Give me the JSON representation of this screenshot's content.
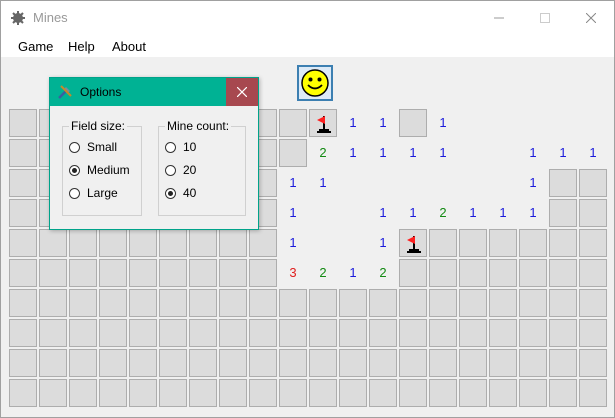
{
  "window": {
    "title": "Mines"
  },
  "menu": {
    "items": [
      "Game",
      "Help",
      "About"
    ]
  },
  "board": {
    "rows": [
      [
        "closed",
        "closed",
        "closed",
        "closed",
        "closed",
        "closed",
        "closed",
        "closed",
        "closed",
        "closed",
        "flag",
        "1",
        "1",
        "closed",
        "1",
        "",
        "",
        "",
        ""
      ],
      [
        "closed",
        "closed",
        "closed",
        "closed",
        "closed",
        "closed",
        "closed",
        "closed",
        "closed",
        "closed",
        "2",
        "1",
        "1",
        "1",
        "1",
        "",
        "",
        "1",
        "1",
        "1"
      ],
      [
        "closed",
        "closed",
        "closed",
        "closed",
        "closed",
        "closed",
        "closed",
        "closed",
        "closed",
        "1",
        "1",
        "",
        "",
        "",
        "",
        "",
        "",
        "1",
        "closed",
        "closed"
      ],
      [
        "closed",
        "closed",
        "closed",
        "closed",
        "closed",
        "closed",
        "closed",
        "closed",
        "closed",
        "1",
        "",
        "",
        "1",
        "1",
        "2",
        "1",
        "1",
        "1",
        "closed",
        "closed"
      ],
      [
        "closed",
        "closed",
        "closed",
        "closed",
        "closed",
        "closed",
        "closed",
        "closed",
        "closed",
        "1",
        "",
        "",
        "1",
        "flag",
        "closed",
        "closed",
        "closed",
        "closed",
        "closed",
        "closed"
      ],
      [
        "closed",
        "closed",
        "closed",
        "closed",
        "closed",
        "closed",
        "closed",
        "closed",
        "closed",
        "3",
        "2",
        "1",
        "2",
        "closed",
        "closed",
        "closed",
        "closed",
        "closed",
        "closed",
        "closed"
      ],
      [
        "closed",
        "closed",
        "closed",
        "closed",
        "closed",
        "closed",
        "closed",
        "closed",
        "closed",
        "closed",
        "closed",
        "closed",
        "closed",
        "closed",
        "closed",
        "closed",
        "closed",
        "closed",
        "closed",
        "closed"
      ],
      [
        "closed",
        "closed",
        "closed",
        "closed",
        "closed",
        "closed",
        "closed",
        "closed",
        "closed",
        "closed",
        "closed",
        "closed",
        "closed",
        "closed",
        "closed",
        "closed",
        "closed",
        "closed",
        "closed",
        "closed"
      ],
      [
        "closed",
        "closed",
        "closed",
        "closed",
        "closed",
        "closed",
        "closed",
        "closed",
        "closed",
        "closed",
        "closed",
        "closed",
        "closed",
        "closed",
        "closed",
        "closed",
        "closed",
        "closed",
        "closed",
        "closed"
      ],
      [
        "closed",
        "closed",
        "closed",
        "closed",
        "closed",
        "closed",
        "closed",
        "closed",
        "closed",
        "closed",
        "closed",
        "closed",
        "closed",
        "closed",
        "closed",
        "closed",
        "closed",
        "closed",
        "closed",
        "closed"
      ]
    ]
  },
  "options_dialog": {
    "title": "Options",
    "field_size": {
      "label": "Field size:",
      "options": [
        "Small",
        "Medium",
        "Large"
      ],
      "selected": "Medium"
    },
    "mine_count": {
      "label": "Mine count:",
      "options": [
        "10",
        "20",
        "40"
      ],
      "selected": "40"
    }
  },
  "colors": {
    "dialog_accent": "#00b294",
    "close_button": "#a7484f",
    "number_1": "#1a1adc",
    "number_2": "#138a13",
    "number_3": "#e02020"
  }
}
